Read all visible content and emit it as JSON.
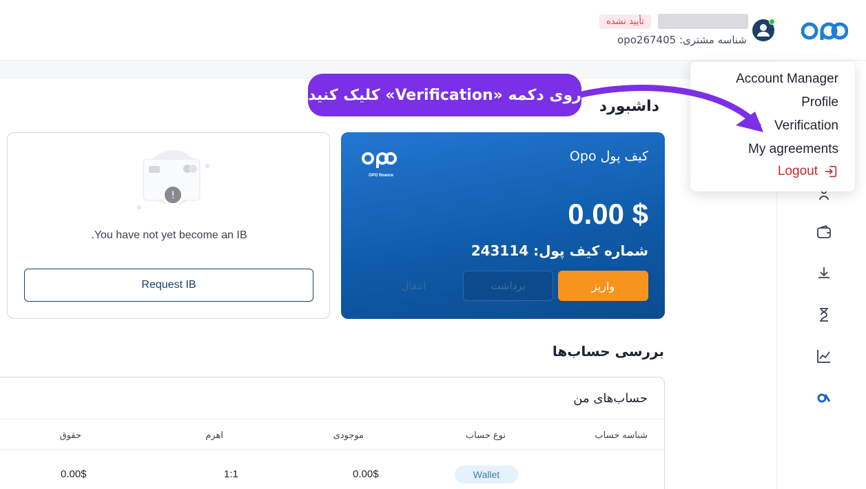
{
  "header": {
    "status_badge": "تأیید نشده",
    "customer_id": "شناسه مشتری: opo267405"
  },
  "page": {
    "title": "داشبورد"
  },
  "wallet": {
    "title": "کیف پول Opo",
    "logo_text": "OPO finance",
    "balance": "0.00 $",
    "number": "شماره کیف پول: 243114",
    "deposit_label": "واریز",
    "withdraw_label": "برداشت",
    "transfer_label": "انتقال",
    "colors": {
      "card": "#0f5cab",
      "deposit": "#f7941d"
    }
  },
  "ib": {
    "message": ".You have not yet become an IB",
    "button_label": "Request IB"
  },
  "accounts_section": {
    "title": "بررسی حساب‌ها"
  },
  "accounts_table": {
    "title": "حساب‌های من",
    "headers": [
      "شناسه حساب",
      "نوع حساب",
      "موجودی",
      "اهرم",
      "حقوق"
    ],
    "rows": [
      {
        "account_type": "Wallet",
        "balance": "0.00$",
        "leverage": "1:1",
        "equity": "0.00$"
      }
    ]
  },
  "dropdown": {
    "items": [
      "Account Manager",
      "Profile",
      "Verification",
      "My agreements"
    ],
    "logout_label": "Logout"
  },
  "annotation": {
    "text": "روی دکمه «Verification» کلیک کنید",
    "color": "#7b2fe6"
  },
  "sidebar": {
    "icons": [
      "user-icon",
      "wallet-icon",
      "download-icon",
      "hourglass-icon",
      "chart-icon",
      "opo-icon"
    ]
  }
}
